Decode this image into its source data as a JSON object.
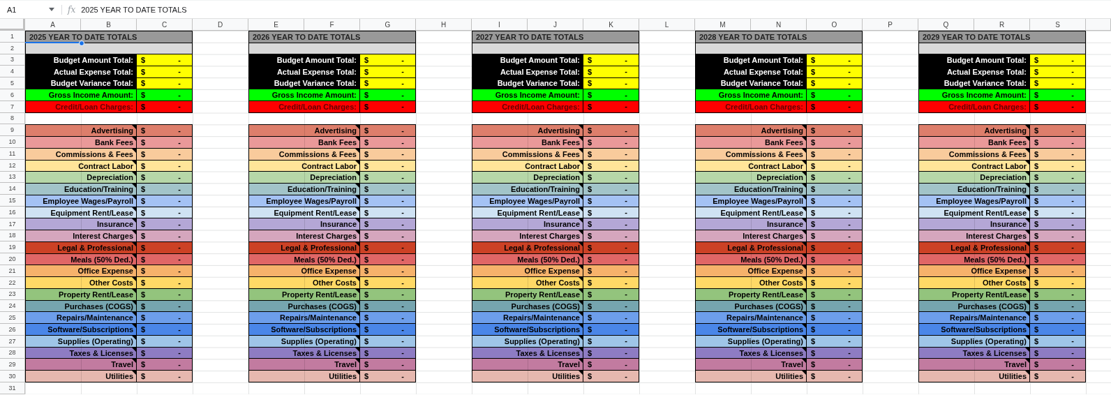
{
  "formula_bar": {
    "cell_ref": "A1",
    "fx": "fx",
    "formula": "2025 YEAR TO DATE TOTALS"
  },
  "column_headers": [
    "A",
    "B",
    "C",
    "D",
    "E",
    "F",
    "G",
    "H",
    "I",
    "J",
    "K",
    "L",
    "M",
    "N",
    "O",
    "P",
    "Q",
    "R",
    "S"
  ],
  "row_numbers": [
    "1",
    "2",
    "3",
    "4",
    "5",
    "6",
    "7",
    "8",
    "9",
    "10",
    "11",
    "12",
    "13",
    "14",
    "15",
    "16",
    "17",
    "18",
    "19",
    "20",
    "21",
    "22",
    "23",
    "24",
    "25",
    "26",
    "27",
    "28",
    "29",
    "30",
    "31"
  ],
  "blocks": [
    {
      "title": "2025 YEAR TO DATE TOTALS",
      "summary": [
        {
          "kind": "total",
          "label": "Budget Amount Total:",
          "symbol": "$",
          "amount": "-"
        },
        {
          "kind": "total",
          "label": "Actual Expense Total:",
          "symbol": "$",
          "amount": "-"
        },
        {
          "kind": "total",
          "label": "Budget Variance Total:",
          "symbol": "$",
          "amount": "-"
        },
        {
          "kind": "income",
          "label": "Gross Income Amount:",
          "symbol": "$",
          "amount": "-"
        },
        {
          "kind": "charges",
          "label": "Credit/Loan Charges:",
          "symbol": "$",
          "amount": "-"
        }
      ],
      "categories": [
        {
          "label": "Advertising",
          "color": "#dd7e6b",
          "note": true,
          "symbol": "$",
          "amount": "-"
        },
        {
          "label": "Bank Fees",
          "color": "#ea9999",
          "note": true,
          "symbol": "$",
          "amount": "-"
        },
        {
          "label": "Commissions & Fees",
          "color": "#f9cb9c",
          "note": true,
          "symbol": "$",
          "amount": "-"
        },
        {
          "label": "Contract Labor",
          "color": "#ffe599",
          "note": true,
          "symbol": "$",
          "amount": "-"
        },
        {
          "label": "Depreciation",
          "color": "#b6d7a8",
          "note": true,
          "symbol": "$",
          "amount": "-"
        },
        {
          "label": "Education/Training",
          "color": "#a2c4c9",
          "note": true,
          "symbol": "$",
          "amount": "-"
        },
        {
          "label": "Employee Wages/Payroll",
          "color": "#a4c2f4",
          "note": true,
          "symbol": "$",
          "amount": "-"
        },
        {
          "label": "Equipment Rent/Lease",
          "color": "#cfe2f3",
          "note": true,
          "symbol": "$",
          "amount": "-"
        },
        {
          "label": "Insurance",
          "color": "#b4a7d6",
          "note": true,
          "symbol": "$",
          "amount": "-"
        },
        {
          "label": "Interest Charges",
          "color": "#d5a6bd",
          "note": true,
          "symbol": "$",
          "amount": "-"
        },
        {
          "label": "Legal & Professional",
          "color": "#cc4125",
          "note": true,
          "symbol": "$",
          "amount": "-"
        },
        {
          "label": "Meals (50% Ded.)",
          "color": "#e06666",
          "note": true,
          "symbol": "$",
          "amount": "-"
        },
        {
          "label": "Office Expense",
          "color": "#f6b26b",
          "note": true,
          "symbol": "$",
          "amount": "-"
        },
        {
          "label": "Other Costs",
          "color": "#ffd966",
          "note": true,
          "symbol": "$",
          "amount": "-"
        },
        {
          "label": "Property Rent/Lease",
          "color": "#93c47d",
          "note": true,
          "symbol": "$",
          "amount": "-"
        },
        {
          "label": "Purchases (COGS)",
          "color": "#76a5af",
          "note": true,
          "symbol": "$",
          "amount": "-"
        },
        {
          "label": "Repairs/Maintenance",
          "color": "#6d9eeb",
          "note": true,
          "symbol": "$",
          "amount": "-"
        },
        {
          "label": "Software/Subscriptions",
          "color": "#4a86e8",
          "note": true,
          "symbol": "$",
          "amount": "-"
        },
        {
          "label": "Supplies (Operating)",
          "color": "#9fc5e8",
          "note": true,
          "symbol": "$",
          "amount": "-"
        },
        {
          "label": "Taxes & Licenses",
          "color": "#8e7cc3",
          "note": true,
          "symbol": "$",
          "amount": "-"
        },
        {
          "label": "Travel",
          "color": "#c27ba0",
          "note": true,
          "symbol": "$",
          "amount": "-"
        },
        {
          "label": "Utilities",
          "color": "#e6b8af",
          "note": true,
          "symbol": "$",
          "amount": "-"
        }
      ]
    },
    {
      "title": "2026 YEAR TO DATE TOTALS",
      "summary": [
        {
          "kind": "total",
          "label": "Budget Amount Total:",
          "symbol": "$",
          "amount": "-"
        },
        {
          "kind": "total",
          "label": "Actual Expense Total:",
          "symbol": "$",
          "amount": "-"
        },
        {
          "kind": "total",
          "label": "Budget Variance Total:",
          "symbol": "$",
          "amount": "-"
        },
        {
          "kind": "income",
          "label": "Gross Income Amount:",
          "symbol": "$",
          "amount": "-"
        },
        {
          "kind": "charges",
          "label": "Credit/Loan Charges:",
          "symbol": "$",
          "amount": "-"
        }
      ],
      "categories": [
        {
          "label": "Advertising",
          "color": "#dd7e6b",
          "note": true,
          "symbol": "$",
          "amount": "-"
        },
        {
          "label": "Bank Fees",
          "color": "#ea9999",
          "note": true,
          "symbol": "$",
          "amount": "-"
        },
        {
          "label": "Commissions & Fees",
          "color": "#f9cb9c",
          "note": true,
          "symbol": "$",
          "amount": "-"
        },
        {
          "label": "Contract Labor",
          "color": "#ffe599",
          "note": true,
          "symbol": "$",
          "amount": "-"
        },
        {
          "label": "Depreciation",
          "color": "#b6d7a8",
          "note": true,
          "symbol": "$",
          "amount": "-"
        },
        {
          "label": "Education/Training",
          "color": "#a2c4c9",
          "note": true,
          "symbol": "$",
          "amount": "-"
        },
        {
          "label": "Employee Wages/Payroll",
          "color": "#a4c2f4",
          "note": true,
          "symbol": "$",
          "amount": "-"
        },
        {
          "label": "Equipment Rent/Lease",
          "color": "#cfe2f3",
          "note": true,
          "symbol": "$",
          "amount": "-"
        },
        {
          "label": "Insurance",
          "color": "#b4a7d6",
          "note": true,
          "symbol": "$",
          "amount": "-"
        },
        {
          "label": "Interest Charges",
          "color": "#d5a6bd",
          "note": true,
          "symbol": "$",
          "amount": "-"
        },
        {
          "label": "Legal & Professional",
          "color": "#cc4125",
          "note": true,
          "symbol": "$",
          "amount": "-"
        },
        {
          "label": "Meals (50% Ded.)",
          "color": "#e06666",
          "note": true,
          "symbol": "$",
          "amount": "-"
        },
        {
          "label": "Office Expense",
          "color": "#f6b26b",
          "note": true,
          "symbol": "$",
          "amount": "-"
        },
        {
          "label": "Other Costs",
          "color": "#ffd966",
          "note": true,
          "symbol": "$",
          "amount": "-"
        },
        {
          "label": "Property Rent/Lease",
          "color": "#93c47d",
          "note": true,
          "symbol": "$",
          "amount": "-"
        },
        {
          "label": "Purchases (COGS)",
          "color": "#76a5af",
          "note": true,
          "symbol": "$",
          "amount": "-"
        },
        {
          "label": "Repairs/Maintenance",
          "color": "#6d9eeb",
          "note": true,
          "symbol": "$",
          "amount": "-"
        },
        {
          "label": "Software/Subscriptions",
          "color": "#4a86e8",
          "note": true,
          "symbol": "$",
          "amount": "-"
        },
        {
          "label": "Supplies (Operating)",
          "color": "#9fc5e8",
          "note": true,
          "symbol": "$",
          "amount": "-"
        },
        {
          "label": "Taxes & Licenses",
          "color": "#8e7cc3",
          "note": true,
          "symbol": "$",
          "amount": "-"
        },
        {
          "label": "Travel",
          "color": "#c27ba0",
          "note": true,
          "symbol": "$",
          "amount": "-"
        },
        {
          "label": "Utilities",
          "color": "#e6b8af",
          "note": true,
          "symbol": "$",
          "amount": "-"
        }
      ]
    },
    {
      "title": "2027 YEAR TO DATE TOTALS",
      "summary": [
        {
          "kind": "total",
          "label": "Budget Amount Total:",
          "symbol": "$",
          "amount": "-"
        },
        {
          "kind": "total",
          "label": "Actual Expense Total:",
          "symbol": "$",
          "amount": "-"
        },
        {
          "kind": "total",
          "label": "Budget Variance Total:",
          "symbol": "$",
          "amount": "-"
        },
        {
          "kind": "income",
          "label": "Gross Income Amount:",
          "symbol": "$",
          "amount": "-"
        },
        {
          "kind": "charges",
          "label": "Credit/Loan Charges:",
          "symbol": "$",
          "amount": "-"
        }
      ],
      "categories": [
        {
          "label": "Advertising",
          "color": "#dd7e6b",
          "note": true,
          "symbol": "$",
          "amount": "-"
        },
        {
          "label": "Bank Fees",
          "color": "#ea9999",
          "note": true,
          "symbol": "$",
          "amount": "-"
        },
        {
          "label": "Commissions & Fees",
          "color": "#f9cb9c",
          "note": true,
          "symbol": "$",
          "amount": "-"
        },
        {
          "label": "Contract Labor",
          "color": "#ffe599",
          "note": true,
          "symbol": "$",
          "amount": "-"
        },
        {
          "label": "Depreciation",
          "color": "#b6d7a8",
          "note": true,
          "symbol": "$",
          "amount": "-"
        },
        {
          "label": "Education/Training",
          "color": "#a2c4c9",
          "note": true,
          "symbol": "$",
          "amount": "-"
        },
        {
          "label": "Employee Wages/Payroll",
          "color": "#a4c2f4",
          "note": true,
          "symbol": "$",
          "amount": "-"
        },
        {
          "label": "Equipment Rent/Lease",
          "color": "#cfe2f3",
          "note": true,
          "symbol": "$",
          "amount": "-"
        },
        {
          "label": "Insurance",
          "color": "#b4a7d6",
          "note": true,
          "symbol": "$",
          "amount": "-"
        },
        {
          "label": "Interest Charges",
          "color": "#d5a6bd",
          "note": true,
          "symbol": "$",
          "amount": "-"
        },
        {
          "label": "Legal & Professional",
          "color": "#cc4125",
          "note": true,
          "symbol": "$",
          "amount": "-"
        },
        {
          "label": "Meals (50% Ded.)",
          "color": "#e06666",
          "note": true,
          "symbol": "$",
          "amount": "-"
        },
        {
          "label": "Office Expense",
          "color": "#f6b26b",
          "note": true,
          "symbol": "$",
          "amount": "-"
        },
        {
          "label": "Other Costs",
          "color": "#ffd966",
          "note": true,
          "symbol": "$",
          "amount": "-"
        },
        {
          "label": "Property Rent/Lease",
          "color": "#93c47d",
          "note": true,
          "symbol": "$",
          "amount": "-"
        },
        {
          "label": "Purchases (COGS)",
          "color": "#76a5af",
          "note": true,
          "symbol": "$",
          "amount": "-"
        },
        {
          "label": "Repairs/Maintenance",
          "color": "#6d9eeb",
          "note": true,
          "symbol": "$",
          "amount": "-"
        },
        {
          "label": "Software/Subscriptions",
          "color": "#4a86e8",
          "note": true,
          "symbol": "$",
          "amount": "-"
        },
        {
          "label": "Supplies (Operating)",
          "color": "#9fc5e8",
          "note": true,
          "symbol": "$",
          "amount": "-"
        },
        {
          "label": "Taxes & Licenses",
          "color": "#8e7cc3",
          "note": true,
          "symbol": "$",
          "amount": "-"
        },
        {
          "label": "Travel",
          "color": "#c27ba0",
          "note": true,
          "symbol": "$",
          "amount": "-"
        },
        {
          "label": "Utilities",
          "color": "#e6b8af",
          "note": true,
          "symbol": "$",
          "amount": "-"
        }
      ]
    },
    {
      "title": "2028 YEAR TO DATE TOTALS",
      "summary": [
        {
          "kind": "total",
          "label": "Budget Amount Total:",
          "symbol": "$",
          "amount": "-"
        },
        {
          "kind": "total",
          "label": "Actual Expense Total:",
          "symbol": "$",
          "amount": "-"
        },
        {
          "kind": "total",
          "label": "Budget Variance Total:",
          "symbol": "$",
          "amount": "-"
        },
        {
          "kind": "income",
          "label": "Gross Income Amount:",
          "symbol": "$",
          "amount": "-"
        },
        {
          "kind": "charges",
          "label": "Credit/Loan Charges:",
          "symbol": "$",
          "amount": "-"
        }
      ],
      "categories": [
        {
          "label": "Advertising",
          "color": "#dd7e6b",
          "note": true,
          "symbol": "$",
          "amount": "-"
        },
        {
          "label": "Bank Fees",
          "color": "#ea9999",
          "note": true,
          "symbol": "$",
          "amount": "-"
        },
        {
          "label": "Commissions & Fees",
          "color": "#f9cb9c",
          "note": true,
          "symbol": "$",
          "amount": "-"
        },
        {
          "label": "Contract Labor",
          "color": "#ffe599",
          "note": true,
          "symbol": "$",
          "amount": "-"
        },
        {
          "label": "Depreciation",
          "color": "#b6d7a8",
          "note": true,
          "symbol": "$",
          "amount": "-"
        },
        {
          "label": "Education/Training",
          "color": "#a2c4c9",
          "note": true,
          "symbol": "$",
          "amount": "-"
        },
        {
          "label": "Employee Wages/Payroll",
          "color": "#a4c2f4",
          "note": true,
          "symbol": "$",
          "amount": "-"
        },
        {
          "label": "Equipment Rent/Lease",
          "color": "#cfe2f3",
          "note": true,
          "symbol": "$",
          "amount": "-"
        },
        {
          "label": "Insurance",
          "color": "#b4a7d6",
          "note": true,
          "symbol": "$",
          "amount": "-"
        },
        {
          "label": "Interest Charges",
          "color": "#d5a6bd",
          "note": true,
          "symbol": "$",
          "amount": "-"
        },
        {
          "label": "Legal & Professional",
          "color": "#cc4125",
          "note": true,
          "symbol": "$",
          "amount": "-"
        },
        {
          "label": "Meals (50% Ded.)",
          "color": "#e06666",
          "note": true,
          "symbol": "$",
          "amount": "-"
        },
        {
          "label": "Office Expense",
          "color": "#f6b26b",
          "note": true,
          "symbol": "$",
          "amount": "-"
        },
        {
          "label": "Other Costs",
          "color": "#ffd966",
          "note": true,
          "symbol": "$",
          "amount": "-"
        },
        {
          "label": "Property Rent/Lease",
          "color": "#93c47d",
          "note": true,
          "symbol": "$",
          "amount": "-"
        },
        {
          "label": "Purchases (COGS)",
          "color": "#76a5af",
          "note": true,
          "symbol": "$",
          "amount": "-"
        },
        {
          "label": "Repairs/Maintenance",
          "color": "#6d9eeb",
          "note": true,
          "symbol": "$",
          "amount": "-"
        },
        {
          "label": "Software/Subscriptions",
          "color": "#4a86e8",
          "note": true,
          "symbol": "$",
          "amount": "-"
        },
        {
          "label": "Supplies (Operating)",
          "color": "#9fc5e8",
          "note": true,
          "symbol": "$",
          "amount": "-"
        },
        {
          "label": "Taxes & Licenses",
          "color": "#8e7cc3",
          "note": true,
          "symbol": "$",
          "amount": "-"
        },
        {
          "label": "Travel",
          "color": "#c27ba0",
          "note": true,
          "symbol": "$",
          "amount": "-"
        },
        {
          "label": "Utilities",
          "color": "#e6b8af",
          "note": true,
          "symbol": "$",
          "amount": "-"
        }
      ]
    },
    {
      "title": "2029 YEAR TO DATE TOTALS",
      "summary": [
        {
          "kind": "total",
          "label": "Budget Amount Total:",
          "symbol": "$",
          "amount": "-"
        },
        {
          "kind": "total",
          "label": "Actual Expense Total:",
          "symbol": "$",
          "amount": "-"
        },
        {
          "kind": "total",
          "label": "Budget Variance Total:",
          "symbol": "$",
          "amount": "-"
        },
        {
          "kind": "income",
          "label": "Gross Income Amount:",
          "symbol": "$",
          "amount": "-"
        },
        {
          "kind": "charges",
          "label": "Credit/Loan Charges:",
          "symbol": "$",
          "amount": "-"
        }
      ],
      "categories": [
        {
          "label": "Advertising",
          "color": "#dd7e6b",
          "note": true,
          "symbol": "$",
          "amount": "-"
        },
        {
          "label": "Bank Fees",
          "color": "#ea9999",
          "note": true,
          "symbol": "$",
          "amount": "-"
        },
        {
          "label": "Commissions & Fees",
          "color": "#f9cb9c",
          "note": true,
          "symbol": "$",
          "amount": "-"
        },
        {
          "label": "Contract Labor",
          "color": "#ffe599",
          "note": true,
          "symbol": "$",
          "amount": "-"
        },
        {
          "label": "Depreciation",
          "color": "#b6d7a8",
          "note": true,
          "symbol": "$",
          "amount": "-"
        },
        {
          "label": "Education/Training",
          "color": "#a2c4c9",
          "note": true,
          "symbol": "$",
          "amount": "-"
        },
        {
          "label": "Employee Wages/Payroll",
          "color": "#a4c2f4",
          "note": true,
          "symbol": "$",
          "amount": "-"
        },
        {
          "label": "Equipment Rent/Lease",
          "color": "#cfe2f3",
          "note": true,
          "symbol": "$",
          "amount": "-"
        },
        {
          "label": "Insurance",
          "color": "#b4a7d6",
          "note": true,
          "symbol": "$",
          "amount": "-"
        },
        {
          "label": "Interest Charges",
          "color": "#d5a6bd",
          "note": true,
          "symbol": "$",
          "amount": "-"
        },
        {
          "label": "Legal & Professional",
          "color": "#cc4125",
          "note": true,
          "symbol": "$",
          "amount": "-"
        },
        {
          "label": "Meals (50% Ded.)",
          "color": "#e06666",
          "note": true,
          "symbol": "$",
          "amount": "-"
        },
        {
          "label": "Office Expense",
          "color": "#f6b26b",
          "note": true,
          "symbol": "$",
          "amount": "-"
        },
        {
          "label": "Other Costs",
          "color": "#ffd966",
          "note": true,
          "symbol": "$",
          "amount": "-"
        },
        {
          "label": "Property Rent/Lease",
          "color": "#93c47d",
          "note": true,
          "symbol": "$",
          "amount": "-"
        },
        {
          "label": "Purchases (COGS)",
          "color": "#76a5af",
          "note": true,
          "symbol": "$",
          "amount": "-"
        },
        {
          "label": "Repairs/Maintenance",
          "color": "#6d9eeb",
          "note": true,
          "symbol": "$",
          "amount": "-"
        },
        {
          "label": "Software/Subscriptions",
          "color": "#4a86e8",
          "note": true,
          "symbol": "$",
          "amount": "-"
        },
        {
          "label": "Supplies (Operating)",
          "color": "#9fc5e8",
          "note": true,
          "symbol": "$",
          "amount": "-"
        },
        {
          "label": "Taxes & Licenses",
          "color": "#8e7cc3",
          "note": true,
          "symbol": "$",
          "amount": "-"
        },
        {
          "label": "Travel",
          "color": "#c27ba0",
          "note": true,
          "symbol": "$",
          "amount": "-"
        },
        {
          "label": "Utilities",
          "color": "#e6b8af",
          "note": true,
          "symbol": "$",
          "amount": "-"
        }
      ]
    }
  ]
}
